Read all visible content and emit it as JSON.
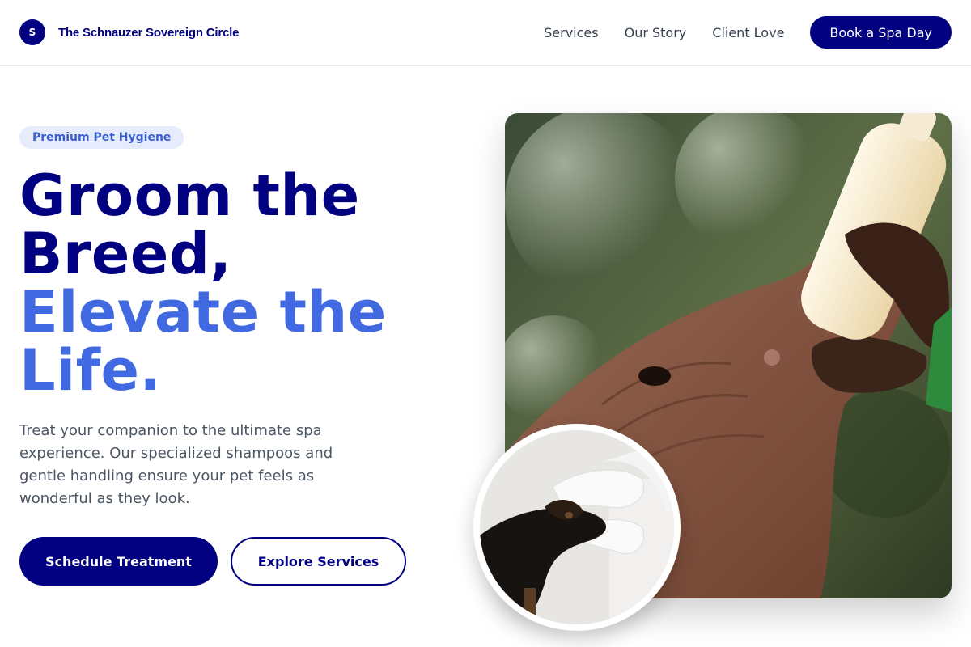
{
  "header": {
    "logo_letter": "S",
    "brand_name": "The Schnauzer Sovereign Circle",
    "nav": [
      {
        "label": "Services"
      },
      {
        "label": "Our Story"
      },
      {
        "label": "Client Love"
      }
    ],
    "cta_label": "Book a Spa Day"
  },
  "hero": {
    "badge": "Premium Pet Hygiene",
    "headline_line1": "Groom the",
    "headline_line2": "Breed,",
    "headline_line3": "Elevate the",
    "headline_line4": "Life.",
    "lead": "Treat your companion to the ultimate spa experience. Our specialized shampoos and gentle handling ensure your pet feels as wonderful as they look.",
    "primary_button": "Schedule Treatment",
    "secondary_button": "Explore Services"
  },
  "images": {
    "main_image": "elephant-bottle-feeding-photo",
    "inset_image": "dachshund-grooming-photo"
  },
  "colors": {
    "primary": "#000080",
    "accent": "#4169e1",
    "badge_bg": "#e6ecfb",
    "badge_text": "#3a5fcd",
    "body_text": "#4b5563"
  }
}
